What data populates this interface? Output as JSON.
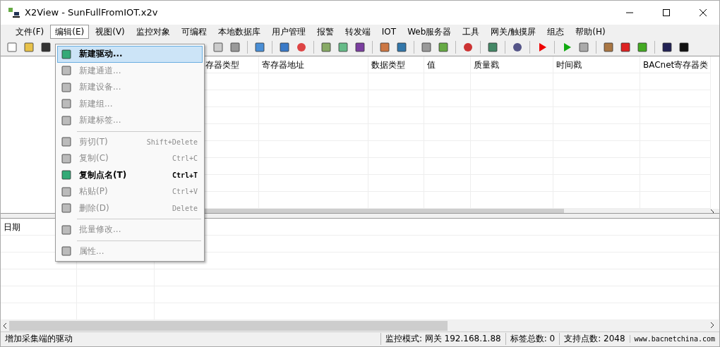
{
  "window": {
    "title": "X2View - SunFullFromIOT.x2v"
  },
  "menubar": [
    {
      "label": "文件(F)",
      "selected": false
    },
    {
      "label": "编辑(E)",
      "selected": true
    },
    {
      "label": "视图(V)",
      "selected": false
    },
    {
      "label": "监控对象",
      "selected": false
    },
    {
      "label": "可编程",
      "selected": false
    },
    {
      "label": "本地数据库",
      "selected": false
    },
    {
      "label": "用户管理",
      "selected": false
    },
    {
      "label": "报警",
      "selected": false
    },
    {
      "label": "转发端",
      "selected": false
    },
    {
      "label": "IOT",
      "selected": false
    },
    {
      "label": "Web服务器",
      "selected": false
    },
    {
      "label": "工具",
      "selected": false
    },
    {
      "label": "网关/触摸屏",
      "selected": false
    },
    {
      "label": "组态",
      "selected": false
    },
    {
      "label": "帮助(H)",
      "selected": false
    }
  ],
  "edit_menu": [
    {
      "kind": "item",
      "label": "新建驱动...",
      "disabled": false,
      "selected": true
    },
    {
      "kind": "item",
      "label": "新建通道...",
      "disabled": true,
      "selected": false
    },
    {
      "kind": "item",
      "label": "新建设备...",
      "disabled": true,
      "selected": false
    },
    {
      "kind": "item",
      "label": "新建组...",
      "disabled": true,
      "selected": false
    },
    {
      "kind": "item",
      "label": "新建标签...",
      "disabled": true,
      "selected": false
    },
    {
      "kind": "separator"
    },
    {
      "kind": "item",
      "label": "剪切(T)",
      "shortcut": "Shift+Delete",
      "disabled": true,
      "selected": false
    },
    {
      "kind": "item",
      "label": "复制(C)",
      "shortcut": "Ctrl+C",
      "disabled": true,
      "selected": false
    },
    {
      "kind": "item",
      "label": "复制点名(T)",
      "shortcut": "Ctrl+T",
      "disabled": false,
      "selected": false
    },
    {
      "kind": "item",
      "label": "粘贴(P)",
      "shortcut": "Ctrl+V",
      "disabled": true,
      "selected": false
    },
    {
      "kind": "item",
      "label": "删除(D)",
      "shortcut": "Delete",
      "disabled": true,
      "selected": false
    },
    {
      "kind": "separator"
    },
    {
      "kind": "item",
      "label": "批量修改...",
      "disabled": true,
      "selected": false
    },
    {
      "kind": "separator"
    },
    {
      "kind": "item",
      "label": "属性...",
      "disabled": true,
      "selected": false
    }
  ],
  "table": {
    "columns": [
      "存器类型",
      "寄存器地址",
      "数据类型",
      "值",
      "质量戳",
      "时间戳",
      "BACnet寄存器类"
    ]
  },
  "log_table": {
    "columns": [
      "日期"
    ]
  },
  "status_bar": [
    "增加采集端的驱动",
    "监控模式: 网关 192.168.1.88",
    "标签总数: 0",
    "支持点数: 2048",
    "www.bacnetchina.com"
  ]
}
